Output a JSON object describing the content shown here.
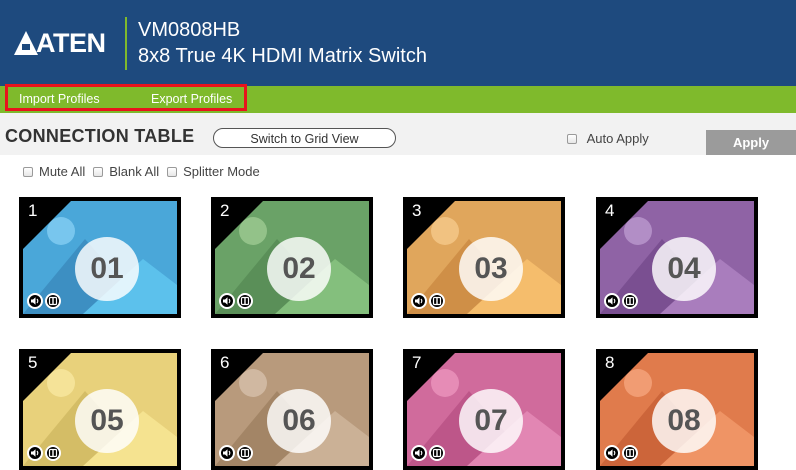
{
  "header": {
    "logo": "ATEN",
    "model": "VM0808HB",
    "subtitle": "8x8 True 4K HDMI Matrix Switch"
  },
  "menu": {
    "import_label": "Import Profiles",
    "export_label": "Export Profiles"
  },
  "toolbar": {
    "title": "CONNECTION TABLE",
    "switch_label": "Switch to Grid View",
    "auto_apply_label": "Auto Apply",
    "apply_label": "Apply"
  },
  "options": {
    "mute_all": "Mute All",
    "blank_all": "Blank All",
    "splitter_mode": "Splitter Mode"
  },
  "colors": {
    "header_bg": "#1e4a7e",
    "accent_green": "#7fba2c",
    "highlight_red": "#e8141c"
  },
  "outputs": [
    {
      "index": "1",
      "source": "01",
      "bg": "#4aa7d9",
      "hill_dark": "#3d8fc2",
      "hill_light": "#5cc1ec",
      "sun": "#9fe0ff"
    },
    {
      "index": "2",
      "source": "02",
      "bg": "#6aa267",
      "hill_dark": "#5a8f58",
      "hill_light": "#84bf7d",
      "sun": "#b5dca6"
    },
    {
      "index": "3",
      "source": "03",
      "bg": "#e0a65c",
      "hill_dark": "#cf8f47",
      "hill_light": "#f5bd6c",
      "sun": "#ffd9a0"
    },
    {
      "index": "4",
      "source": "04",
      "bg": "#8f63a5",
      "hill_dark": "#7a4f91",
      "hill_light": "#a97dbd",
      "sun": "#d0b3e2"
    },
    {
      "index": "5",
      "source": "05",
      "bg": "#e8d17b",
      "hill_dark": "#d4bd66",
      "hill_light": "#f5e390",
      "sun": "#fff2b0"
    },
    {
      "index": "6",
      "source": "06",
      "bg": "#b89a7c",
      "hill_dark": "#a38566",
      "hill_light": "#cbb196",
      "sun": "#e4d2bf"
    },
    {
      "index": "7",
      "source": "07",
      "bg": "#d06b9c",
      "hill_dark": "#bd5689",
      "hill_light": "#e286b3",
      "sun": "#f7a8cc"
    },
    {
      "index": "8",
      "source": "08",
      "bg": "#e07b4c",
      "hill_dark": "#cc653a",
      "hill_light": "#ef9465",
      "sun": "#ffb894"
    }
  ]
}
